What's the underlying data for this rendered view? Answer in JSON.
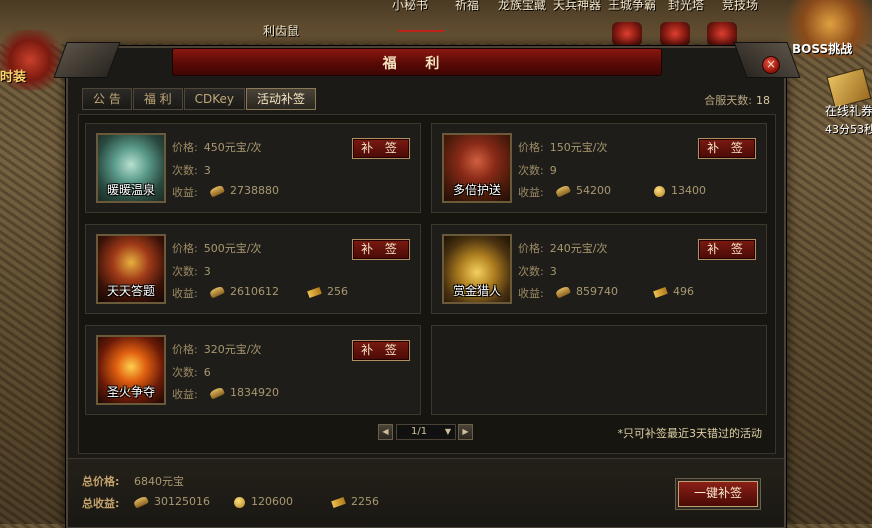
{
  "background": {
    "top_labels": [
      "小秘书",
      "祈福",
      "龙族宝藏",
      "天兵神器",
      "王城争霸",
      "封光塔",
      "竞技场"
    ],
    "npc_name": "利齿鼠",
    "left_text": "时装",
    "boss_label": "BOSS挑战",
    "gift_label": "在线礼券",
    "gift_timer": "43分53秒"
  },
  "window": {
    "title": "福 利",
    "close_label": "×",
    "tabs": [
      "公 告",
      "福 利",
      "CDKey",
      "活动补签"
    ],
    "active_tab": 3,
    "server_days_label": "合服天数:",
    "server_days_value": "18"
  },
  "labels": {
    "price": "价格:",
    "times": "次数:",
    "gain": "收益:",
    "sign_button": "补 签"
  },
  "activities": [
    {
      "name": "暖暖温泉",
      "price": "450元宝/次",
      "times": "3",
      "gains": [
        {
          "icon": "ingot-icon",
          "value": "2738880"
        }
      ]
    },
    {
      "name": "多倍护送",
      "price": "150元宝/次",
      "times": "9",
      "gains": [
        {
          "icon": "ingot-icon",
          "value": "54200"
        },
        {
          "icon": "coin-icon",
          "value": "13400"
        }
      ]
    },
    {
      "name": "天天答题",
      "price": "500元宝/次",
      "times": "3",
      "gains": [
        {
          "icon": "ingot-icon",
          "value": "2610612"
        },
        {
          "icon": "ticket-icon",
          "value": "256"
        }
      ]
    },
    {
      "name": "赏金猎人",
      "price": "240元宝/次",
      "times": "3",
      "gains": [
        {
          "icon": "ingot-icon",
          "value": "859740"
        },
        {
          "icon": "ticket-icon",
          "value": "496"
        }
      ]
    },
    {
      "name": "圣火争夺",
      "price": "320元宝/次",
      "times": "6",
      "gains": [
        {
          "icon": "ingot-icon",
          "value": "1834920"
        }
      ]
    }
  ],
  "pager": {
    "prev": "◀",
    "page": "1/1",
    "dropdown": "▼",
    "next": "▶"
  },
  "note": "*只可补签最近3天错过的活动",
  "footer": {
    "total_price_label": "总价格:",
    "total_price_value": "6840元宝",
    "total_gain_label": "总收益:",
    "total_ingot": "30125016",
    "total_coin": "120600",
    "total_ticket": "2256",
    "sign_all_button": "一键补签"
  },
  "colors": {
    "accent_red": "#7a1a12",
    "gold_text": "#c2a26a",
    "panel_bg": "#1b1a17"
  }
}
